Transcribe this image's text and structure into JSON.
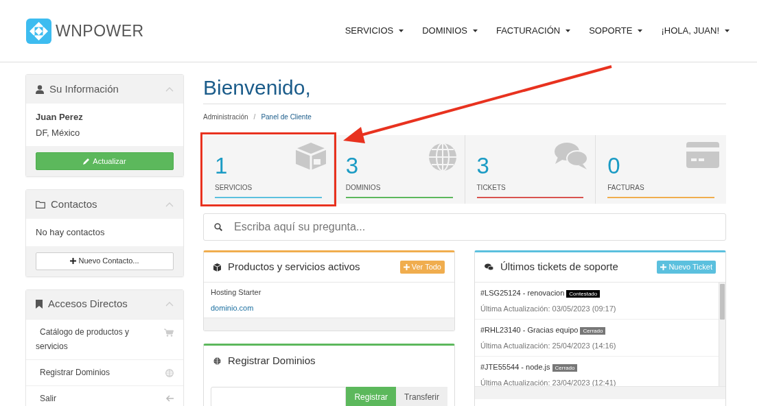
{
  "brand": {
    "name": "WNPOWER"
  },
  "nav": [
    {
      "label": "SERVICIOS"
    },
    {
      "label": "DOMINIOS"
    },
    {
      "label": "FACTURACIÓN"
    },
    {
      "label": "SOPORTE"
    },
    {
      "label": "¡HOLA, JUAN!"
    }
  ],
  "profile_panel": {
    "title": "Su Información",
    "name": "Juan Perez",
    "location": "DF, México",
    "button": "Actualizar"
  },
  "contacts_panel": {
    "title": "Contactos",
    "empty_text": "No hay contactos",
    "button": "Nuevo Contacto..."
  },
  "shortcuts_panel": {
    "title": "Accesos Directos",
    "items": [
      {
        "label": "Catálogo de productos y servicios"
      },
      {
        "label": "Registrar Dominios"
      },
      {
        "label": "Salir"
      }
    ]
  },
  "page_title": "Bienvenido,",
  "breadcrumb": {
    "separator": "/",
    "items": [
      {
        "label": "Administración",
        "current": false
      },
      {
        "label": "Panel de Cliente",
        "current": true
      }
    ]
  },
  "stats": [
    {
      "value": "1",
      "label": "SERVICIOS",
      "color": "#5bc0de",
      "highlighted": true
    },
    {
      "value": "3",
      "label": "DOMINIOS",
      "color": "#5cb85c",
      "highlighted": false
    },
    {
      "value": "3",
      "label": "TICKETS",
      "color": "#d9534f",
      "highlighted": false
    },
    {
      "value": "0",
      "label": "FACTURAS",
      "color": "#f0ad4e",
      "highlighted": false
    }
  ],
  "search": {
    "placeholder": "Escriba aquí su pregunta..."
  },
  "products_panel": {
    "title": "Productos y servicios activos",
    "button": "Ver Todo",
    "items": [
      {
        "name": "Hosting Starter",
        "domain": "dominio.com"
      }
    ]
  },
  "domains_panel": {
    "title": "Registrar Dominios",
    "buttons": [
      {
        "label": "Registrar",
        "selected": true
      },
      {
        "label": "Transferir",
        "selected": false
      }
    ]
  },
  "tickets_panel": {
    "title": "Últimos tickets de soporte",
    "button": "Nuevo Ticket",
    "tickets": [
      {
        "subject": "#LSG25124 - renovacion",
        "status": "Contestado",
        "color": "#000000",
        "updated": "Última Actualización: 03/05/2023 (09:17)"
      },
      {
        "subject": "#RHL23140 - Gracias equipo",
        "status": "Cerrado",
        "color": "#777777",
        "updated": "Última Actualización: 25/04/2023 (14:16)"
      },
      {
        "subject": "#JTE55544 - node.js",
        "status": "Cerrado",
        "color": "#777777",
        "updated": "Última Actualización: 23/04/2023 (12:41)"
      }
    ]
  }
}
